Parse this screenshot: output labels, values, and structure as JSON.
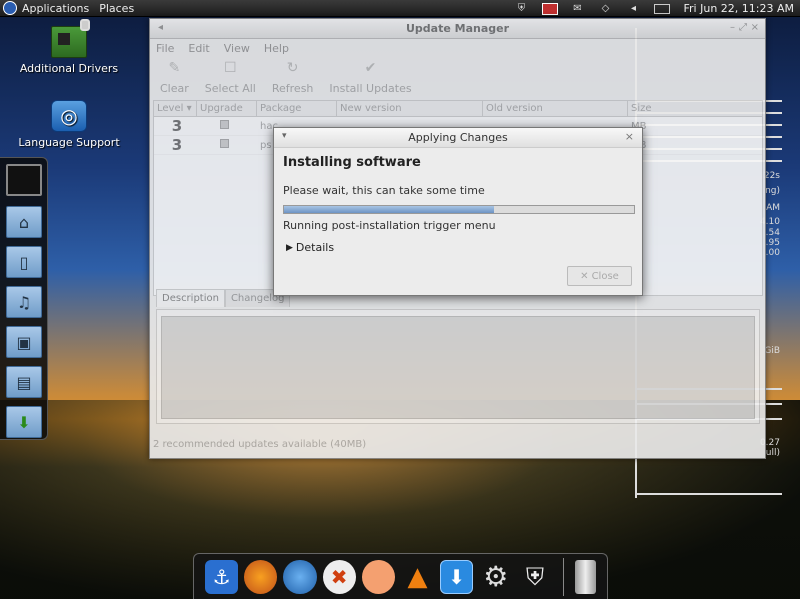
{
  "top_panel": {
    "menus": [
      "Applications",
      "Places"
    ],
    "clock": "Fri Jun 22, 11:23 AM"
  },
  "desktop": {
    "icons": [
      {
        "label": "Additional Drivers",
        "icon": "driver-chip-icon"
      },
      {
        "label": "Language Support",
        "icon": "language-globe-icon"
      }
    ]
  },
  "conky": {
    "values": [
      "22s",
      "ng)",
      "AM",
      "4.10",
      ".54",
      ".95",
      ".00",
      "GiB",
      "0.27",
      "ull)"
    ]
  },
  "update_manager": {
    "title": "Update Manager",
    "menu": [
      "File",
      "Edit",
      "View",
      "Help"
    ],
    "toolbar": {
      "clear": "Clear",
      "select_all": "Select All",
      "refresh": "Refresh",
      "install": "Install Updates"
    },
    "columns": {
      "level": "Level",
      "upgrade": "Upgrade",
      "package": "Package",
      "new_version": "New version",
      "old_version": "Old version",
      "size": "Size"
    },
    "rows": [
      {
        "level": "3",
        "package": "hac",
        "size": "MB"
      },
      {
        "level": "3",
        "package": "ps",
        "size": "MB"
      }
    ],
    "tabs": {
      "description": "Description",
      "changelog": "Changelog"
    },
    "status": "2 recommended updates available (40MB)"
  },
  "dialog": {
    "title": "Applying Changes",
    "heading": "Installing software",
    "subtitle": "Please wait, this can take some time",
    "progress": 0.6,
    "status": "Running post-installation trigger menu",
    "details_label": "Details",
    "close_label": "Close"
  }
}
